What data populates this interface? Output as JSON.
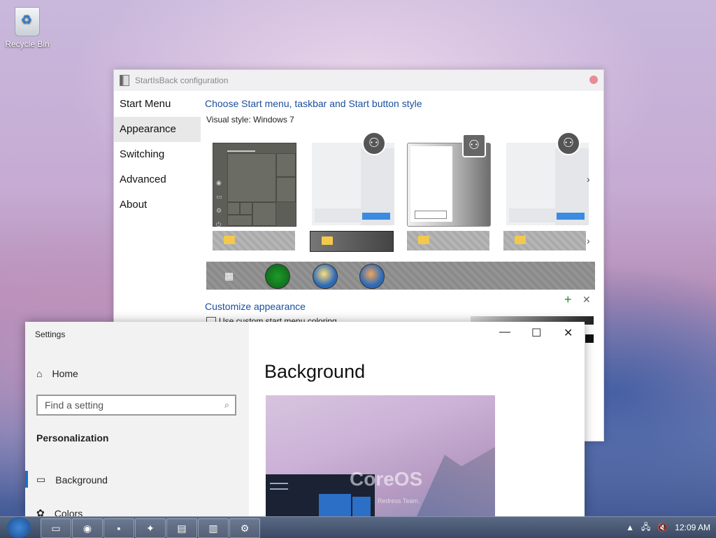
{
  "desktop": {
    "recycle_bin_label": "Recycle Bin"
  },
  "startisback": {
    "title": "StartIsBack configuration",
    "nav": [
      "Start Menu",
      "Appearance",
      "Switching",
      "Advanced",
      "About"
    ],
    "heading": "Choose Start menu, taskbar and Start button style",
    "visual_style_label": "Visual style:",
    "visual_style_value": "Windows 7",
    "customize_heading": "Customize appearance",
    "checkbox_label": "Use custom start menu coloring"
  },
  "settings": {
    "title": "Settings",
    "home_label": "Home",
    "search_placeholder": "Find a setting",
    "section": "Personalization",
    "nav": [
      "Background",
      "Colors"
    ],
    "page_title": "Background",
    "preview_title": "CoreOS",
    "preview_subtitle": "Redress Team."
  },
  "taskbar": {
    "time": "12:09 AM"
  },
  "icons": [
    "recycle-bin-icon",
    "startisback-app-icon",
    "user-avatar-icon",
    "folder-icon",
    "home-icon",
    "search-icon",
    "picture-icon",
    "palette-icon",
    "minimize-icon",
    "maximize-icon",
    "close-icon",
    "start-orb-icon",
    "explorer-icon",
    "chrome-icon",
    "cmd-icon",
    "network-icon",
    "volume-icon",
    "gear-icon"
  ]
}
